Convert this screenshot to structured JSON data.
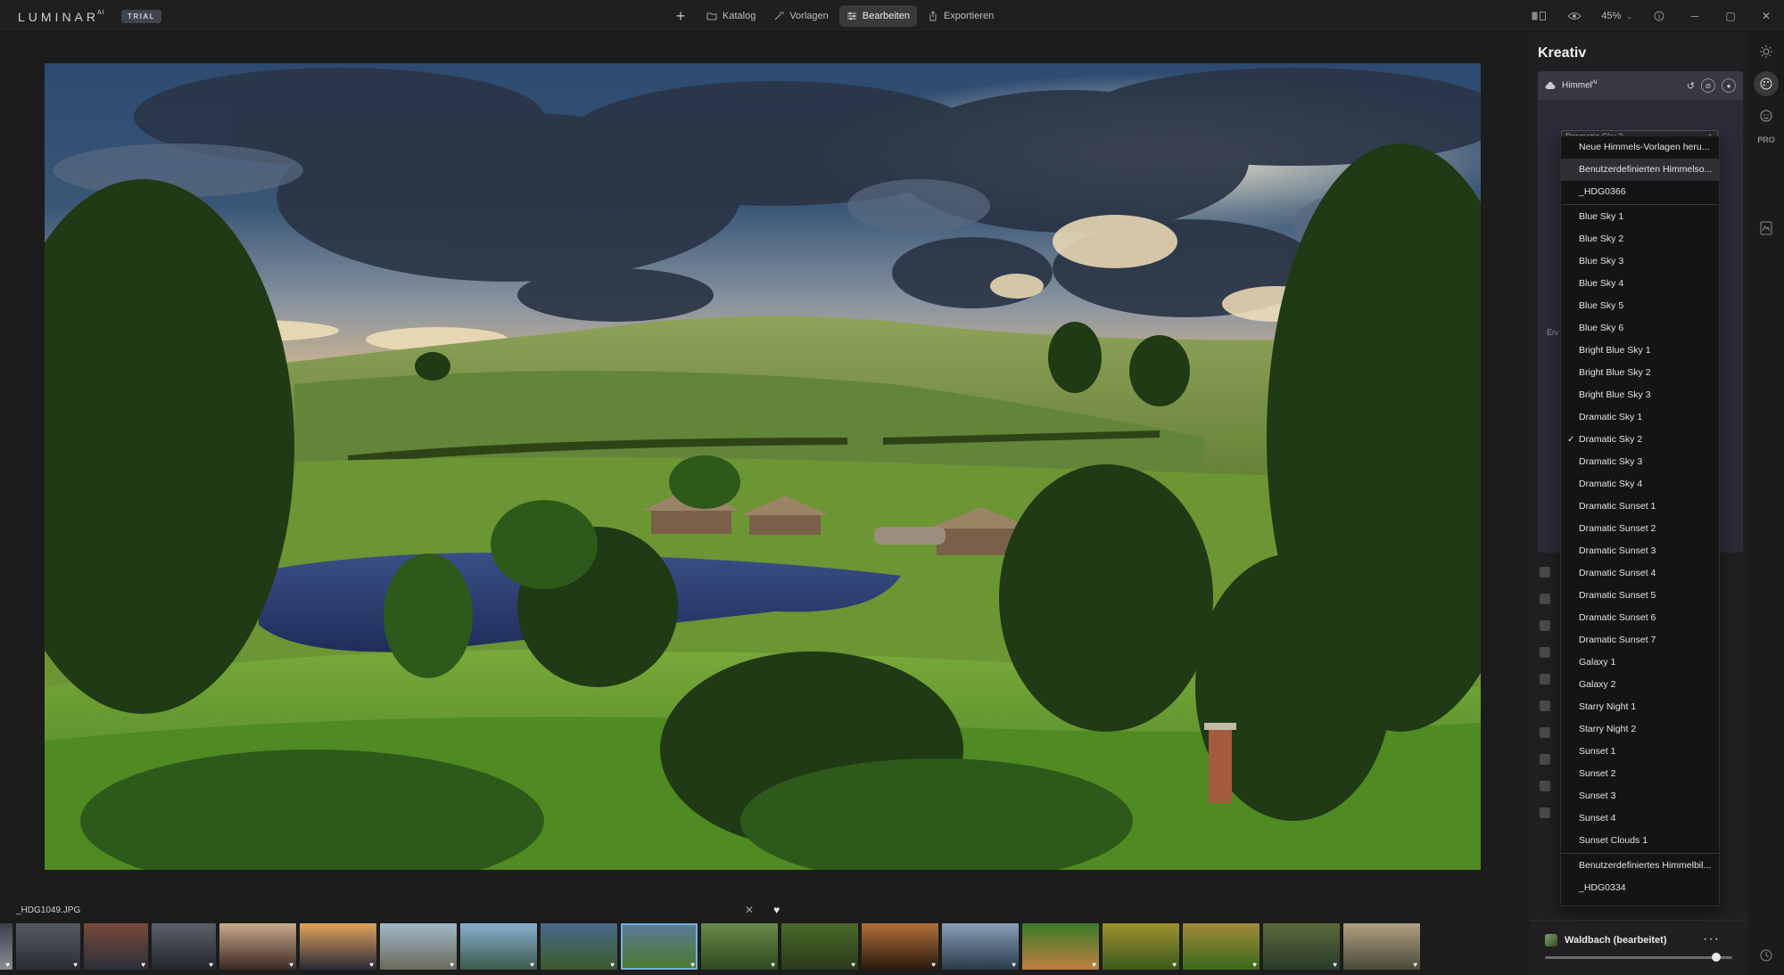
{
  "app": {
    "logo": "LUMINAR",
    "logo_sup": "AI",
    "badge": "TRIAL"
  },
  "nav": {
    "add_label": "+",
    "items": [
      {
        "label": "Katalog",
        "icon": "folder-icon"
      },
      {
        "label": "Vorlagen",
        "icon": "magic-icon"
      },
      {
        "label": "Bearbeiten",
        "icon": "sliders-icon",
        "active": true
      },
      {
        "label": "Exportieren",
        "icon": "export-icon"
      }
    ]
  },
  "toolbar": {
    "zoom": "45%"
  },
  "panel": {
    "title": "Kreativ",
    "tool_name": "Himmel",
    "tool_sup": "AI",
    "select_value": "Dramatic Sky 2",
    "partial_label": "Erv"
  },
  "dropdown": {
    "top_items": [
      "Neue Himmels-Vorlagen heru...",
      "Benutzerdefinierten Himmelso...",
      "_HDG0366"
    ],
    "presets": [
      "Blue Sky 1",
      "Blue Sky 2",
      "Blue Sky 3",
      "Blue Sky 4",
      "Blue Sky 5",
      "Blue Sky 6",
      "Bright Blue Sky 1",
      "Bright Blue Sky 2",
      "Bright Blue Sky 3",
      "Dramatic Sky 1",
      "Dramatic Sky 2",
      "Dramatic Sky 3",
      "Dramatic Sky 4",
      "Dramatic Sunset 1",
      "Dramatic Sunset 2",
      "Dramatic Sunset 3",
      "Dramatic Sunset 4",
      "Dramatic Sunset 5",
      "Dramatic Sunset 6",
      "Dramatic Sunset 7",
      "Galaxy 1",
      "Galaxy 2",
      "Starry Night 1",
      "Starry Night 2",
      "Sunset 1",
      "Sunset 2",
      "Sunset 3",
      "Sunset 4",
      "Sunset Clouds 1"
    ],
    "selected": "Dramatic Sky 2",
    "bottom_items": [
      "Benutzerdefiniertes Himmelbil...",
      "_HDG0334"
    ]
  },
  "filmstrip": {
    "filename": "_HDG1049.JPG"
  },
  "footer": {
    "title": "Waldbach (bearbeitet)",
    "menu": "···"
  },
  "rail": {
    "pro_label": "PRO"
  },
  "colors": {
    "accent_selected": "#6fb3d9",
    "panel_card": "#2e2b38"
  }
}
